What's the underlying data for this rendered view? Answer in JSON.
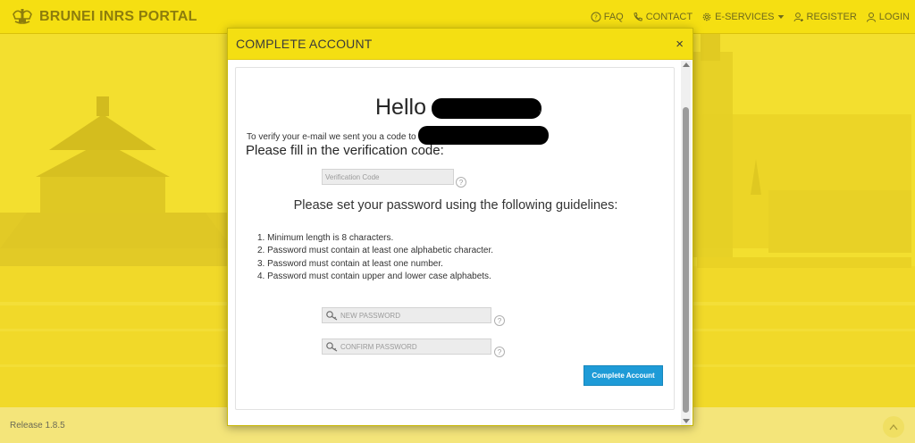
{
  "header": {
    "brand": "BRUNEI INRS PORTAL",
    "nav": [
      {
        "label": "FAQ",
        "icon": "help-circle-icon"
      },
      {
        "label": "CONTACT",
        "icon": "phone-icon"
      },
      {
        "label": "E-SERVICES",
        "icon": "gear-icon"
      },
      {
        "label": "REGISTER",
        "icon": "user-plus-icon"
      },
      {
        "label": "LOGIN",
        "icon": "user-icon"
      }
    ]
  },
  "modal": {
    "title": "COMPLETE ACCOUNT",
    "close": "×",
    "greeting": "Hello",
    "greeting_suffix": ",",
    "verify_text": "To verify your e-mail we sent you a code to",
    "fill_code_text": "Please fill in the verification code:",
    "verification_placeholder": "Verification Code",
    "password_heading": "Please set your password using the following guidelines:",
    "guidelines": [
      "1. Minimum length is 8 characters.",
      "2. Password must contain at least one alphabetic character.",
      "3. Password must contain at least one number.",
      "4. Password must contain upper and lower case alphabets."
    ],
    "new_password_placeholder": "NEW PASSWORD",
    "confirm_password_placeholder": "CONFIRM PASSWORD",
    "help_glyph": "?",
    "submit_label": "Complete Account"
  },
  "footer": {
    "release": "Release 1.8.5"
  },
  "colors": {
    "header_bg": "#f5df12",
    "accent_button": "#1e9bd7",
    "brand_text": "#8d7d0c"
  }
}
